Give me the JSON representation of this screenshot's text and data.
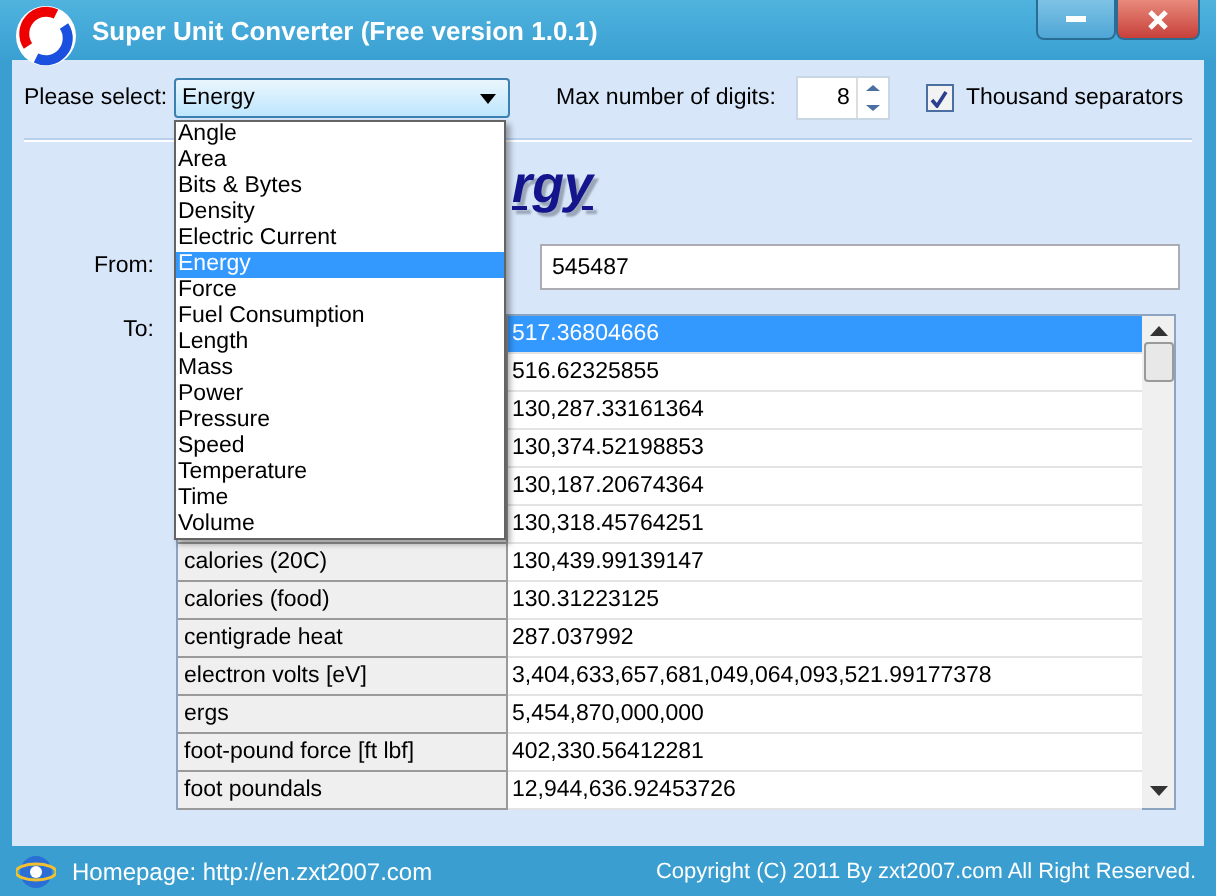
{
  "window": {
    "title": "Super Unit Converter (Free version 1.0.1)"
  },
  "category": {
    "label": "Please select:",
    "value": "Energy",
    "expanded": true,
    "options": [
      {
        "label": "Angle",
        "selected": false
      },
      {
        "label": "Area",
        "selected": false
      },
      {
        "label": "Bits & Bytes",
        "selected": false
      },
      {
        "label": "Density",
        "selected": false
      },
      {
        "label": "Electric Current",
        "selected": false
      },
      {
        "label": "Energy",
        "selected": true
      },
      {
        "label": "Force",
        "selected": false
      },
      {
        "label": "Fuel Consumption",
        "selected": false
      },
      {
        "label": "Length",
        "selected": false
      },
      {
        "label": "Mass",
        "selected": false
      },
      {
        "label": "Power",
        "selected": false
      },
      {
        "label": "Pressure",
        "selected": false
      },
      {
        "label": "Speed",
        "selected": false
      },
      {
        "label": "Temperature",
        "selected": false
      },
      {
        "label": "Time",
        "selected": false
      },
      {
        "label": "Volume",
        "selected": false
      }
    ]
  },
  "digits": {
    "label": "Max number of digits:",
    "value": "8"
  },
  "thousand_separators": {
    "label": "Thousand separators",
    "checked": true
  },
  "heading": "rgy",
  "from": {
    "label": "From:",
    "value": "545487"
  },
  "to": {
    "label": "To:",
    "rows": [
      {
        "value": "517.36804666",
        "selected": true
      },
      {
        "value": "516.62325855",
        "selected": false
      },
      {
        "value": "130,287.33161364",
        "selected": false
      },
      {
        "value": "130,374.52198853",
        "selected": false
      },
      {
        "value": "130,187.20674364",
        "selected": false
      },
      {
        "value": "130,318.45764251",
        "selected": false
      },
      {
        "unit": "calories (20C)",
        "value": "130,439.99139147",
        "selected": false
      },
      {
        "unit": "calories (food)",
        "value": "130.31223125",
        "selected": false
      },
      {
        "unit": "centigrade heat",
        "value": "287.037992",
        "selected": false
      },
      {
        "unit": "electron volts [eV]",
        "value": "3,404,633,657,681,049,064,093,521.99177378",
        "selected": false
      },
      {
        "unit": "ergs",
        "value": "5,454,870,000,000",
        "selected": false
      },
      {
        "unit": "foot-pound force [ft lbf]",
        "value": "402,330.56412281",
        "selected": false
      },
      {
        "unit": "foot poundals",
        "value": "12,944,636.92453726",
        "selected": false
      }
    ]
  },
  "status_bar": {
    "homepage": "Homepage: http://en.zxt2007.com",
    "copyright": "Copyright (C) 2011 By zxt2007.com All Right Reserved."
  }
}
